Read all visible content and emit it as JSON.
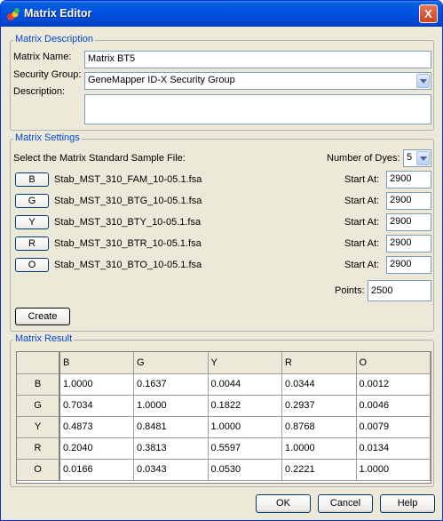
{
  "window": {
    "title": "Matrix Editor",
    "close_glyph": "X"
  },
  "description_group": {
    "title": "Matrix Description",
    "name_label": "Matrix Name:",
    "name_value": "Matrix BT5",
    "security_label": "Security Group:",
    "security_value": "GeneMapper ID-X Security Group",
    "description_label": "Description:",
    "description_value": ""
  },
  "settings_group": {
    "title": "Matrix Settings",
    "select_label": "Select the Matrix Standard Sample File:",
    "num_dyes_label": "Number of Dyes:",
    "num_dyes_value": "5",
    "dyes": [
      {
        "button": "B",
        "file": "Stab_MST_310_FAM_10-05.1.fsa",
        "start_label": "Start At:",
        "start_value": "2900"
      },
      {
        "button": "G",
        "file": "Stab_MST_310_BTG_10-05.1.fsa",
        "start_label": "Start At:",
        "start_value": "2900"
      },
      {
        "button": "Y",
        "file": "Stab_MST_310_BTY_10-05.1.fsa",
        "start_label": "Start At:",
        "start_value": "2900"
      },
      {
        "button": "R",
        "file": "Stab_MST_310_BTR_10-05.1.fsa",
        "start_label": "Start At:",
        "start_value": "2900"
      },
      {
        "button": "O",
        "file": "Stab_MST_310_BTO_10-05.1.fsa",
        "start_label": "Start At:",
        "start_value": "2900"
      }
    ],
    "points_label": "Points:",
    "points_value": "2500",
    "create_label": "Create"
  },
  "result_group": {
    "title": "Matrix Result",
    "columns": [
      "B",
      "G",
      "Y",
      "R",
      "O"
    ],
    "rows": [
      {
        "label": "B",
        "values": [
          "1.0000",
          "0.1637",
          "0.0044",
          "0.0344",
          "0.0012"
        ]
      },
      {
        "label": "G",
        "values": [
          "0.7034",
          "1.0000",
          "0.1822",
          "0.2937",
          "0.0046"
        ]
      },
      {
        "label": "Y",
        "values": [
          "0.4873",
          "0.8481",
          "1.0000",
          "0.8768",
          "0.0079"
        ]
      },
      {
        "label": "R",
        "values": [
          "0.2040",
          "0.3813",
          "0.5597",
          "1.0000",
          "0.0134"
        ]
      },
      {
        "label": "O",
        "values": [
          "0.0166",
          "0.0343",
          "0.0530",
          "0.2221",
          "1.0000"
        ]
      }
    ]
  },
  "footer": {
    "ok_label": "OK",
    "cancel_label": "Cancel",
    "help_label": "Help"
  },
  "colors": {
    "titlebar": "#0054e3",
    "group_title": "#0046d5",
    "dialog_bg": "#ece9d8"
  },
  "icons": {
    "window_icon": "matrix-editor-icon",
    "close": "close-icon",
    "dropdown": "chevron-down-icon"
  }
}
